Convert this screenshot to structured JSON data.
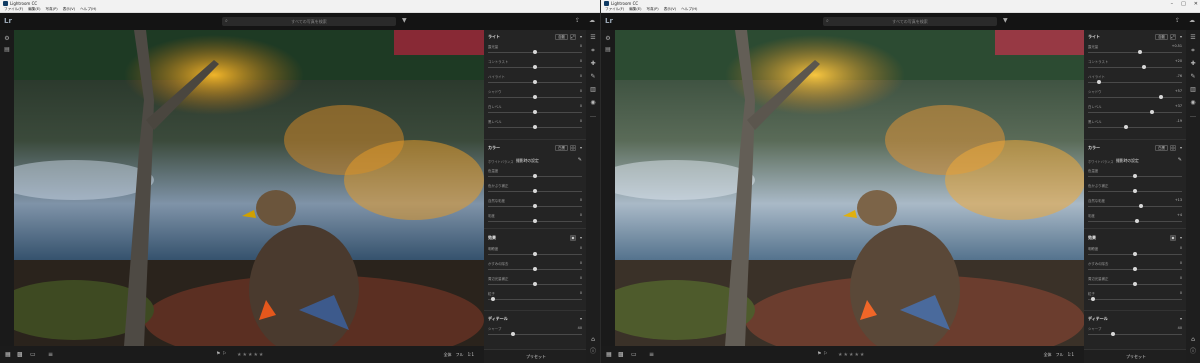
{
  "app": {
    "title": "Lightroom CC",
    "logo_text": "Lr"
  },
  "menu": [
    "ファイル(F)",
    "編集(E)",
    "写真(P)",
    "表示(V)",
    "ヘルプ(H)"
  ],
  "search": {
    "placeholder": "すべての写真を検索"
  },
  "bottombar": {
    "zoom_fit": "全体",
    "zoom_fill": "フル",
    "zoom_100": "1:1"
  },
  "panel": {
    "light": {
      "title": "ライト",
      "auto_label": "自動",
      "left_sliders": [
        {
          "label": "露光量",
          "value": "0",
          "pos": 0.5
        },
        {
          "label": "コントラスト",
          "value": "0",
          "pos": 0.5
        },
        {
          "label": "ハイライト",
          "value": "0",
          "pos": 0.5
        },
        {
          "label": "シャドウ",
          "value": "0",
          "pos": 0.5
        },
        {
          "label": "白レベル",
          "value": "0",
          "pos": 0.5
        },
        {
          "label": "黒レベル",
          "value": "0",
          "pos": 0.5
        }
      ],
      "right_sliders": [
        {
          "label": "露光量",
          "value": "+0.51",
          "pos": 0.55
        },
        {
          "label": "コントラスト",
          "value": "+20",
          "pos": 0.6
        },
        {
          "label": "ハイライト",
          "value": "-76",
          "pos": 0.12
        },
        {
          "label": "シャドウ",
          "value": "+57",
          "pos": 0.78
        },
        {
          "label": "白レベル",
          "value": "+37",
          "pos": 0.68
        },
        {
          "label": "黒レベル",
          "value": "-19",
          "pos": 0.4
        }
      ]
    },
    "color": {
      "title": "カラー",
      "auto_label": "白黒",
      "wb_label": "ホワイトバランス",
      "wb_value": "撮影時の設定",
      "left_sliders": [
        {
          "label": "色温度",
          "value": "",
          "pos": 0.5
        },
        {
          "label": "色かぶり補正",
          "value": "",
          "pos": 0.5
        },
        {
          "label": "自然な彩度",
          "value": "0",
          "pos": 0.5
        },
        {
          "label": "彩度",
          "value": "0",
          "pos": 0.5
        }
      ],
      "right_sliders": [
        {
          "label": "色温度",
          "value": "",
          "pos": 0.5
        },
        {
          "label": "色かぶり補正",
          "value": "",
          "pos": 0.5
        },
        {
          "label": "自然な彩度",
          "value": "+13",
          "pos": 0.56
        },
        {
          "label": "彩度",
          "value": "+4",
          "pos": 0.52
        }
      ]
    },
    "effects": {
      "title": "効果",
      "sliders": [
        {
          "label": "明瞭度",
          "value": "0",
          "pos": 0.5
        },
        {
          "label": "かすみの除去",
          "value": "0",
          "pos": 0.5
        },
        {
          "label": "周辺光量補正",
          "value": "0",
          "pos": 0.5
        },
        {
          "label": "粒子",
          "value": "0",
          "pos": 0.05
        }
      ]
    },
    "detail": {
      "title": "ディテール",
      "sliders": [
        {
          "label": "シャープ",
          "value": "40",
          "pos": 0.27
        }
      ]
    },
    "preset_label": "プリセット"
  }
}
